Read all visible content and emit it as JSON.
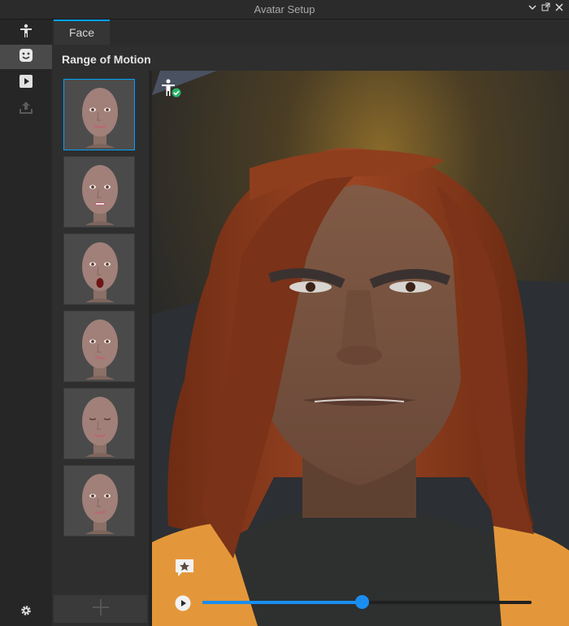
{
  "window": {
    "title": "Avatar Setup"
  },
  "rail": {
    "items": [
      {
        "name": "body",
        "icon": "body-icon"
      },
      {
        "name": "face",
        "icon": "face-icon",
        "active": true
      },
      {
        "name": "animation",
        "icon": "play-icon"
      },
      {
        "name": "upload",
        "icon": "upload-icon",
        "disabled": true
      }
    ],
    "settings_icon": "gear-icon"
  },
  "tabs": [
    {
      "label": "Face",
      "active": true
    }
  ],
  "section": {
    "title": "Range of Motion"
  },
  "thumbnails": {
    "count": 6,
    "selected_index": 0,
    "add_icon": "plus-icon"
  },
  "viewport": {
    "status_icon": "avatar-check-icon",
    "comment_icon": "comment-star-icon",
    "play_icon": "play-circle-icon"
  },
  "timeline": {
    "progress": 0.485
  },
  "colors": {
    "accent": "#00a2ff",
    "timeline": "#1a8ef0",
    "check": "#29b36a",
    "hair": "#8a3a1c",
    "skin": "#7a5642",
    "jacket": "#e79a3a"
  }
}
